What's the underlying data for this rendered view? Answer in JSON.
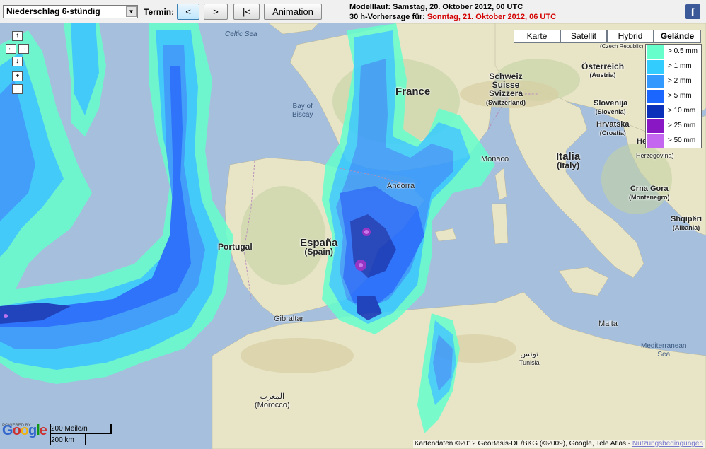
{
  "toolbar": {
    "product_select": "Niederschlag 6-stündig",
    "termin_label": "Termin:",
    "prev_label": "<",
    "next_label": ">",
    "first_label": "|<",
    "animation_label": "Animation",
    "run_line": "Modelllauf: Samstag, 20. Oktober 2012, 00 UTC",
    "forecast_prefix": "30 h-Vorhersage für:",
    "forecast_date": "Sonntag, 21. Oktober 2012, 06 UTC",
    "facebook_icon": "facebook-icon"
  },
  "map": {
    "map_types": [
      "Karte",
      "Satellit",
      "Hybrid",
      "Gelände"
    ],
    "selected_map_type": "Gelände",
    "nav": {
      "up": "↑",
      "left": "←",
      "right": "→",
      "down": "↓",
      "zoom_in": "+",
      "zoom_out": "−"
    },
    "labels": {
      "celtic_sea": "Celtic Sea",
      "bay_of_biscay_1": "Bay of",
      "bay_of_biscay_2": "Biscay",
      "france": "France",
      "schweiz_1": "Schweiz",
      "schweiz_2": "Suisse",
      "schweiz_3": "Svizzera",
      "schweiz_4": "(Switzerland)",
      "osterreich": "Österreich",
      "osterreich_sub": "(Austria)",
      "czech": "(Czech Republic)",
      "slovenija": "Slovenija",
      "slovenija_sub": "(Slovenia)",
      "hrvatska": "Hrvatska",
      "hrvatska_sub": "(Croatia)",
      "bosnia_1": "He",
      "bosnia_2": "Herzegovina)",
      "monaco": "Monaco",
      "italia": "Italia",
      "italia_sub": "(Italy)",
      "andorra": "Andorra",
      "espana": "España",
      "espana_sub": "(Spain)",
      "portugal": "Portugal",
      "crna_gora": "Crna Gora",
      "crna_gora_sub": "(Montenegro)",
      "shqiperi": "Shqipëri",
      "shqiperi_sub": "(Albania)",
      "gibraltar": "Gibraltar",
      "malta": "Malta",
      "tunis_ar": "تونس",
      "tunis": "Tunisia",
      "morocco_ar": "المغرب",
      "morocco": "(Morocco)",
      "med_sea_1": "Mediterranean",
      "med_sea_2": "Sea"
    }
  },
  "legend": {
    "items": [
      {
        "label": "> 0.5 mm",
        "color": "#66ffcc"
      },
      {
        "label": "> 1 mm",
        "color": "#33ccff"
      },
      {
        "label": "> 2 mm",
        "color": "#3399ff"
      },
      {
        "label": "> 5 mm",
        "color": "#1a66ff"
      },
      {
        "label": "> 10 mm",
        "color": "#0a2fb8"
      },
      {
        "label": "> 25 mm",
        "color": "#8a17c4"
      },
      {
        "label": "> 50 mm",
        "color": "#c466f0"
      }
    ]
  },
  "footer": {
    "powered_by": "POWERED BY",
    "google": "Google",
    "scale_miles": "200 Meile/n",
    "scale_km": "200 km",
    "copyright": "Kartendaten ©2012 GeoBasis-DE/BKG (©2009), Google, Tele Atlas -",
    "terms_link": "Nutzungsbedingungen"
  }
}
